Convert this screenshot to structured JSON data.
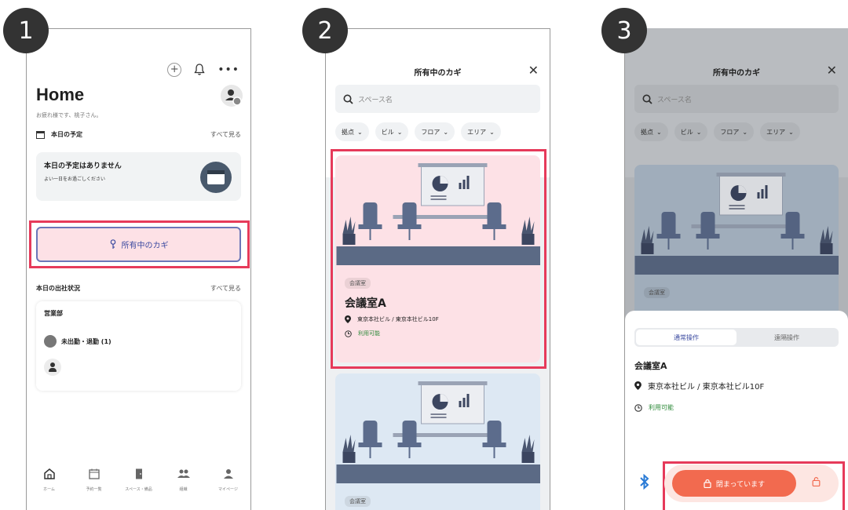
{
  "steps": [
    "1",
    "2",
    "3"
  ],
  "screen1": {
    "title": "Home",
    "greeting": "お疲れ様です、桃子さん。",
    "schedule_section": "本日の予定",
    "see_all": "すべて見る",
    "schedule_empty_title": "本日の予定はありません",
    "schedule_empty_sub": "よい一日をお過ごしください",
    "keys_button": "所有中のカギ",
    "attendance_section": "本日の出社状況",
    "dept": "営業部",
    "absent_label": "未出勤・退勤 (1)",
    "nav": [
      {
        "label": "ホーム",
        "icon": "home-icon"
      },
      {
        "label": "予約一覧",
        "icon": "calendar-icon"
      },
      {
        "label": "スペース・備品",
        "icon": "door-icon"
      },
      {
        "label": "組織",
        "icon": "group-icon"
      },
      {
        "label": "マイページ",
        "icon": "person-icon"
      }
    ]
  },
  "screen2": {
    "title": "所有中のカギ",
    "search_placeholder": "スペース名",
    "filters": [
      "拠点",
      "ビル",
      "フロア",
      "エリア"
    ],
    "card_tag": "会議室",
    "room_name": "会議室A",
    "location": "東京本社ビル / 東京本社ビル10F",
    "status": "利用可能",
    "card2_tag": "会議室"
  },
  "screen3": {
    "title": "所有中のカギ",
    "search_placeholder": "スペース名",
    "filters": [
      "拠点",
      "ビル",
      "フロア",
      "エリア"
    ],
    "card_tag": "会議室",
    "tabs": [
      "通常操作",
      "遠隔操作"
    ],
    "room_name": "会議室A",
    "location": "東京本社ビル / 東京本社ビル10F",
    "status": "利用可能",
    "lock_label": "閉まっています"
  },
  "colors": {
    "highlight": "#e63a5a",
    "pink_card": "#fde1e6",
    "blue_card": "#dde8f3",
    "lock_orange": "#f26a4f",
    "available_green": "#2e8a3a",
    "bluetooth": "#2a7bd6"
  }
}
